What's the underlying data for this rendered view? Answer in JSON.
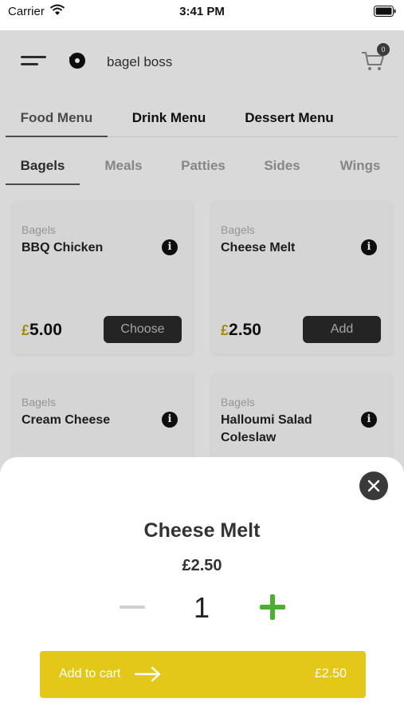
{
  "status_bar": {
    "carrier": "Carrier",
    "time": "3:41 PM"
  },
  "header": {
    "brand": "bagel boss",
    "cart_count": "0"
  },
  "menu_tabs": [
    {
      "label": "Food Menu",
      "active": true
    },
    {
      "label": "Drink Menu",
      "active": false
    },
    {
      "label": "Dessert Menu",
      "active": false
    }
  ],
  "category_tabs": [
    {
      "label": "Bagels",
      "active": true
    },
    {
      "label": "Meals",
      "active": false
    },
    {
      "label": "Patties",
      "active": false
    },
    {
      "label": "Sides",
      "active": false
    },
    {
      "label": "Wings",
      "active": false
    }
  ],
  "products": [
    {
      "category": "Bagels",
      "name": "BBQ Chicken",
      "price_symbol": "£",
      "price": "5.00",
      "button": "Choose"
    },
    {
      "category": "Bagels",
      "name": "Cheese Melt",
      "price_symbol": "£",
      "price": "2.50",
      "button": "Add"
    },
    {
      "category": "Bagels",
      "name": "Cream Cheese"
    },
    {
      "category": "Bagels",
      "name": "Halloumi Salad Coleslaw"
    }
  ],
  "sheet": {
    "title": "Cheese Melt",
    "price": "£2.50",
    "quantity": "1",
    "add_to_cart_label": "Add to cart",
    "add_to_cart_total": "£2.50"
  },
  "colors": {
    "accent_yellow": "#e3c81a",
    "plus_green": "#4caf2f",
    "button_dark": "#2a2a2a",
    "close_dark": "#3a3a3a"
  },
  "icons": {
    "menu": "hamburger-menu-icon",
    "logo": "bagel-logo-icon",
    "cart": "shopping-cart-icon",
    "info": "info-icon",
    "close": "close-icon",
    "arrow": "arrow-right-icon",
    "wifi": "wifi-icon",
    "battery": "battery-icon"
  }
}
